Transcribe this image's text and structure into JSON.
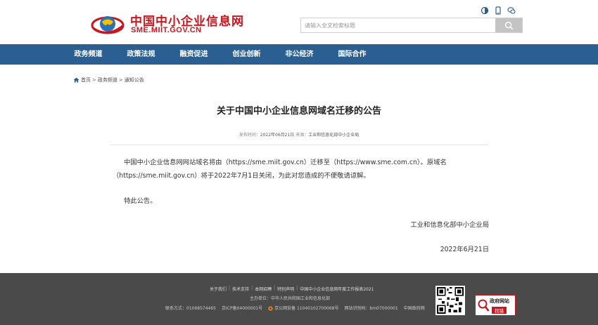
{
  "header": {
    "site_title": "中国中小企业信息网",
    "site_domain": "SME.MIIT.GOV.CN",
    "top_icons": [
      "accessibility-icon",
      "mobile-icon",
      "wechat-icon"
    ],
    "search_placeholder": "请输入全文检索标题",
    "brand_color": "#c8171e"
  },
  "nav": {
    "color": "#2c5f91",
    "items": [
      "政务频道",
      "政策法规",
      "融资促进",
      "创业创新",
      "非公经济",
      "国际合作"
    ]
  },
  "breadcrumb": [
    "首页",
    "政务频道",
    "通知公告"
  ],
  "article": {
    "title": "关于中国中小企业信息网域名迁移的公告",
    "publish_label": "发布时间：",
    "publish_date": "2022年06月21日",
    "source_label": "来源：",
    "source": "工业和信息化部中小企业局",
    "body": "中国中小企业信息网网站域名将由（https://sme.miit.gov.cn）迁移至（https://www.sme.com.cn）。原域名（https://sme.miit.gov.cn）将于2022年7月1日关闭，为此对您造成的不便敬请谅解。",
    "notice": "特此公告。",
    "signature": "工业和信息化部中小企业局",
    "date": "2022年6月21日"
  },
  "footer": {
    "links": [
      "关于我们",
      "技术支持",
      "本网招聘",
      "特别声明",
      "中国中小企业信息网年度工作报表2021"
    ],
    "host": "主办单位：中华人民共和国工业和信息化部",
    "contact": "联系方式：01068574465",
    "icp": "京ICP备04000001号",
    "police": "京公网安备 11040102700068号",
    "site_code": "网站识别码：bm07000001",
    "gov_link": "中国政府网",
    "badge_top": "政府网站",
    "badge_bottom": "找错"
  }
}
